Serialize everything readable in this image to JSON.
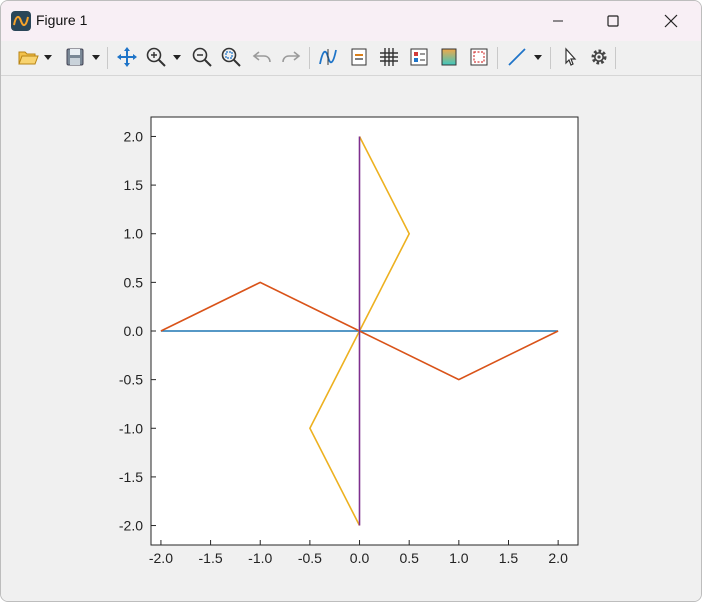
{
  "window": {
    "title": "Figure 1",
    "app_icon": "matlab-figure-icon",
    "controls": [
      "minimize-icon",
      "maximize-icon",
      "close-icon"
    ]
  },
  "toolbar": {
    "items": [
      "open-file-icon",
      "save-icon",
      "pan-icon",
      "zoom-in-icon",
      "zoom-out-icon",
      "zoom-fit-icon",
      "undo-icon",
      "redo-icon",
      "data-cursor-icon",
      "insert-legend-icon",
      "grid-icon",
      "property-inspector-icon",
      "colorbar-icon",
      "plot-edit-icon",
      "line-style-icon",
      "select-pointer-icon",
      "settings-gear-icon"
    ]
  },
  "chart_data": {
    "type": "line",
    "title": "",
    "xlabel": "",
    "ylabel": "",
    "xlim": [
      -2.1,
      2.2
    ],
    "ylim": [
      -2.2,
      2.2
    ],
    "grid": false,
    "legend": "none",
    "xticks": [
      "-2.0",
      "-1.5",
      "-1.0",
      "-0.5",
      "0.0",
      "0.5",
      "1.0",
      "1.5",
      "2.0"
    ],
    "yticks": [
      "2.0",
      "1.5",
      "1.0",
      "0.5",
      "0.0",
      "-0.5",
      "-1.0",
      "-1.5",
      "-2.0"
    ],
    "series": [
      {
        "color": "#1f77b4",
        "x": [
          -2,
          0,
          2
        ],
        "y": [
          0,
          0,
          0
        ]
      },
      {
        "color": "#d95319",
        "x": [
          -2,
          -1,
          0,
          1,
          2
        ],
        "y": [
          0,
          0.5,
          0,
          -0.5,
          0
        ]
      },
      {
        "color": "#edb120",
        "x": [
          0,
          0.5,
          0,
          -0.5,
          0
        ],
        "y": [
          2,
          1,
          0,
          -1,
          -2
        ]
      },
      {
        "color": "#7e2f8e",
        "x": [
          0,
          0
        ],
        "y": [
          2,
          -2
        ]
      }
    ]
  }
}
